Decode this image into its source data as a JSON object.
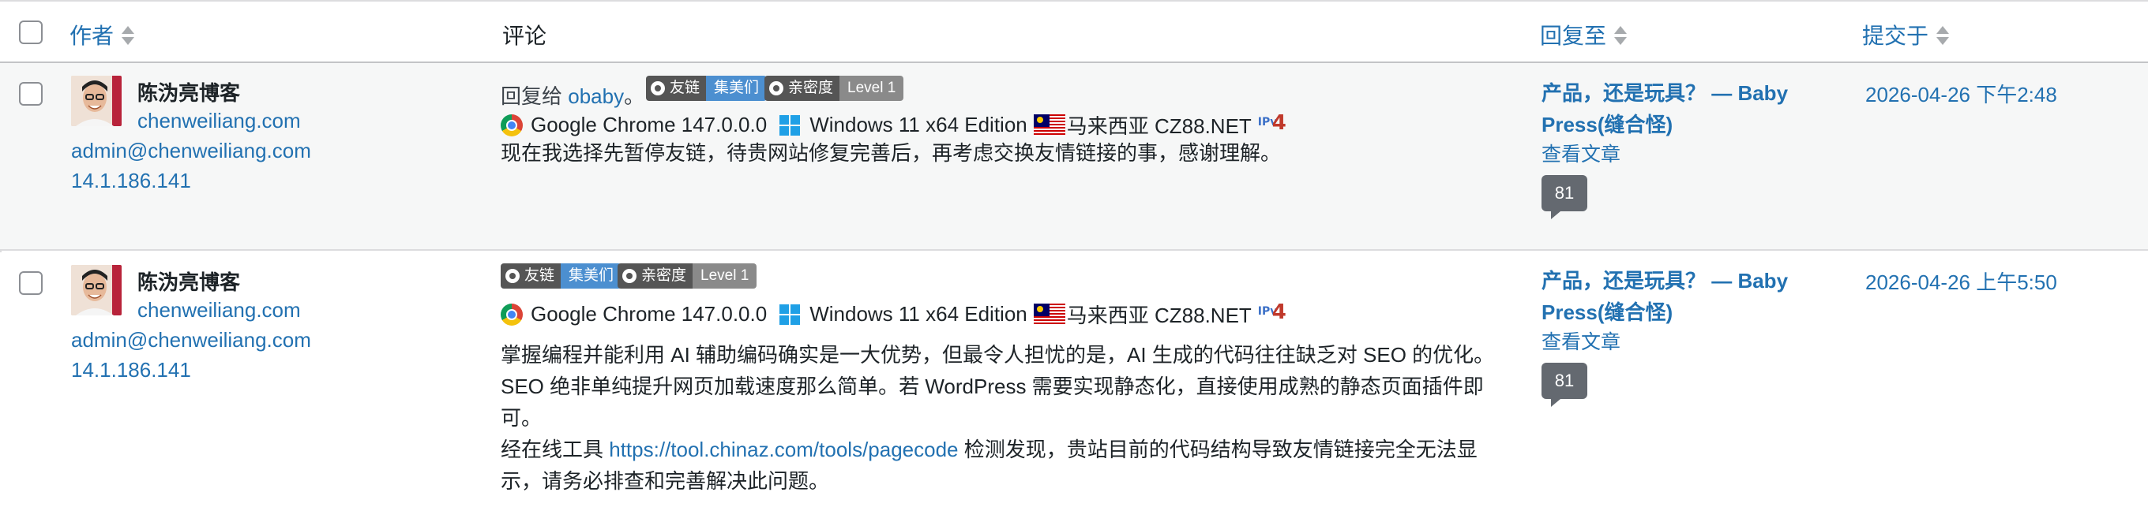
{
  "header": {
    "author_label": "作者",
    "comment_label": "评论",
    "reply_to_label": "回复至",
    "submitted_label": "提交于"
  },
  "comments": [
    {
      "author_name": "陈沩亮博客",
      "author_site": "chenweiliang.com",
      "author_email": "admin@chenweiliang.com",
      "author_ip": "14.1.186.141",
      "reply_prefix": "回复给",
      "reply_to_user": "obaby",
      "reply_suffix": "。",
      "badge_friend_left": "友链",
      "badge_friend_right": "集美们",
      "badge_level_left": "亲密度",
      "badge_level_right": "Level 1",
      "browser": "Google Chrome 147.0.0.0",
      "os": "Windows 11 x64 Edition",
      "location": "马来西亚 CZ88.NET",
      "text_lines": [
        "现在我选择先暂停友链，待贵网站修复完善后，再考虑交换友情链接的事，感谢理解。"
      ],
      "post_title_line1": "产品，还是玩具？ — Baby",
      "post_title_line2": "Press(缝合怪)",
      "view_post": "查看文章",
      "comment_count": "81",
      "date": "2026-04-26 下午2:48"
    },
    {
      "author_name": "陈沩亮博客",
      "author_site": "chenweiliang.com",
      "author_email": "admin@chenweiliang.com",
      "author_ip": "14.1.186.141",
      "badge_friend_left": "友链",
      "badge_friend_right": "集美们",
      "badge_level_left": "亲密度",
      "badge_level_right": "Level 1",
      "browser": "Google Chrome 147.0.0.0",
      "os": "Windows 11 x64 Edition",
      "location": "马来西亚 CZ88.NET",
      "text_lines": [
        "掌握编程并能利用 AI 辅助编码确实是一大优势，但最令人担忧的是，AI 生成的代码往往缺乏对 SEO 的优化。",
        "SEO 绝非单纯提升网页加载速度那么简单。若 WordPress 需要实现静态化，直接使用成熟的静态页面插件即",
        "可。"
      ],
      "tool_prefix": "经在线工具",
      "tool_url": "https://tool.chinaz.com/tools/pagecode",
      "tool_suffix": "检测发现，贵站目前的代码结构导致友情链接完全无法显",
      "last_line": "示，请务必排查和完善解决此问题。",
      "post_title_line1": "产品，还是玩具？ — Baby",
      "post_title_line2": "Press(缝合怪)",
      "view_post": "查看文章",
      "comment_count": "81",
      "date": "2026-04-26 上午5:50"
    }
  ]
}
